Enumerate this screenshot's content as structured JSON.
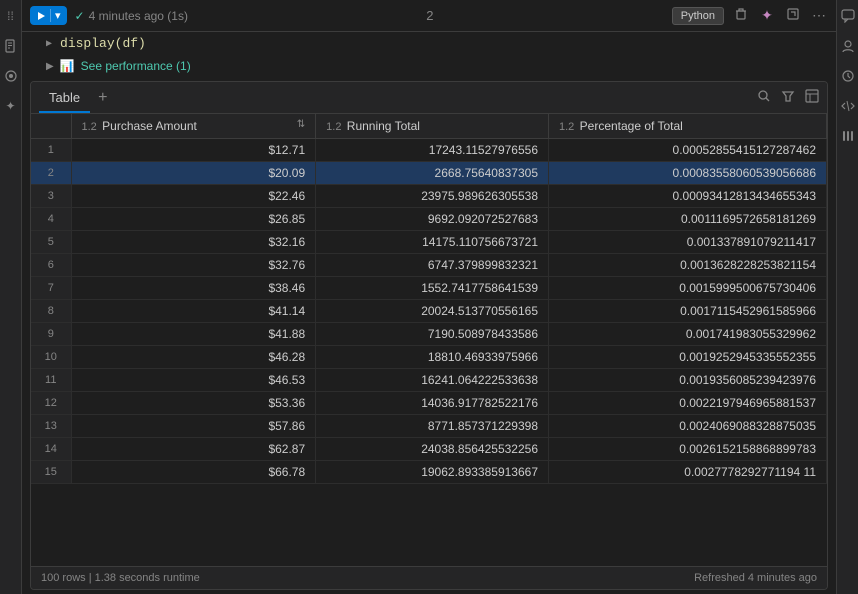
{
  "sidebar_left": {
    "icons": [
      "≡",
      "▷",
      "◎",
      "★",
      "⬡"
    ]
  },
  "cell_toolbar": {
    "run_label": "",
    "status_text": "4 minutes ago (1s)",
    "cell_number": "2",
    "python_label": "Python",
    "actions": [
      "delete",
      "sparkle",
      "expand",
      "more"
    ]
  },
  "code": {
    "display_text": "display(df)"
  },
  "performance": {
    "label": "See performance (1)"
  },
  "table": {
    "tab_label": "Table",
    "add_label": "+",
    "columns": [
      {
        "id": "row_num",
        "label": "",
        "type": ""
      },
      {
        "id": "purchase_amount",
        "label": "Purchase Amount",
        "type": "1.2"
      },
      {
        "id": "running_total",
        "label": "Running Total",
        "type": "1.2"
      },
      {
        "id": "percentage_of_total",
        "label": "Percentage of Total",
        "type": "1.2"
      }
    ],
    "rows": [
      {
        "num": 1,
        "purchase_amount": "$12.71",
        "running_total": "17243.11527976556",
        "percentage_of_total": "0.00052855415127287462",
        "highlighted": false
      },
      {
        "num": 2,
        "purchase_amount": "$20.09",
        "running_total": "2668.75640837305",
        "percentage_of_total": "0.00083558060539056686",
        "highlighted": true
      },
      {
        "num": 3,
        "purchase_amount": "$22.46",
        "running_total": "23975.989626305538",
        "percentage_of_total": "0.00093412813434655343",
        "highlighted": false
      },
      {
        "num": 4,
        "purchase_amount": "$26.85",
        "running_total": "9692.092072527683",
        "percentage_of_total": "0.0011169572658181269",
        "highlighted": false
      },
      {
        "num": 5,
        "purchase_amount": "$32.16",
        "running_total": "14175.110756673721",
        "percentage_of_total": "0.001337891079211417",
        "highlighted": false
      },
      {
        "num": 6,
        "purchase_amount": "$32.76",
        "running_total": "6747.379899832321",
        "percentage_of_total": "0.0013628228253821154",
        "highlighted": false
      },
      {
        "num": 7,
        "purchase_amount": "$38.46",
        "running_total": "1552.7417758641539",
        "percentage_of_total": "0.0015999500675730406",
        "highlighted": false
      },
      {
        "num": 8,
        "purchase_amount": "$41.14",
        "running_total": "20024.513770556165",
        "percentage_of_total": "0.0017115452961585966",
        "highlighted": false
      },
      {
        "num": 9,
        "purchase_amount": "$41.88",
        "running_total": "7190.508978433586",
        "percentage_of_total": "0.001741983055329962",
        "highlighted": false
      },
      {
        "num": 10,
        "purchase_amount": "$46.28",
        "running_total": "18810.46933975966",
        "percentage_of_total": "0.0019252945335552355",
        "highlighted": false
      },
      {
        "num": 11,
        "purchase_amount": "$46.53",
        "running_total": "16241.064222533638",
        "percentage_of_total": "0.0019356085239423976",
        "highlighted": false
      },
      {
        "num": 12,
        "purchase_amount": "$53.36",
        "running_total": "14036.917782522176",
        "percentage_of_total": "0.0022197946965881537",
        "highlighted": false
      },
      {
        "num": 13,
        "purchase_amount": "$57.86",
        "running_total": "8771.857371229398",
        "percentage_of_total": "0.0024069088328875035",
        "highlighted": false
      },
      {
        "num": 14,
        "purchase_amount": "$62.87",
        "running_total": "24038.856425532256",
        "percentage_of_total": "0.0026152158868899783",
        "highlighted": false
      },
      {
        "num": 15,
        "purchase_amount": "$66.78",
        "running_total": "19062.893385913667",
        "percentage_of_total": "0.0027778292771194 11",
        "highlighted": false
      }
    ],
    "footer": {
      "left": "100 rows  |  1.38 seconds runtime",
      "right": "Refreshed 4 minutes ago"
    }
  },
  "sidebar_right": {
    "icons": [
      "💬",
      "👤",
      "↺",
      "{}",
      "≡"
    ]
  }
}
